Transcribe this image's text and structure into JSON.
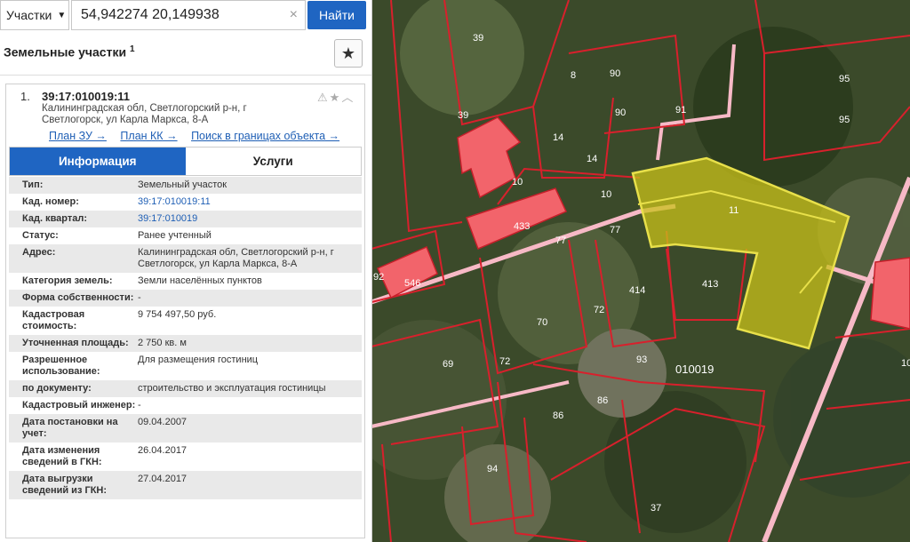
{
  "search": {
    "layer_select": "Участки",
    "query": "54,942274 20,149938",
    "find_button": "Найти"
  },
  "section": {
    "title": "Земельные участки",
    "count": "1"
  },
  "result": {
    "index": "1.",
    "cad_number": "39:17:010019:11",
    "address": "Калининградская обл, Светлогорский р-н, г Светлогорск, ул Карла Маркса, 8-А",
    "links": [
      "План ЗУ →",
      "План КК →",
      "Поиск в границах объекта →"
    ],
    "tabs": [
      "Информация",
      "Услуги"
    ],
    "rows": [
      {
        "k": "Тип:",
        "v": "Земельный участок"
      },
      {
        "k": "Кад. номер:",
        "v": "39:17:010019:11"
      },
      {
        "k": "Кад. квартал:",
        "v": "39:17:010019"
      },
      {
        "k": "Статус:",
        "v": "Ранее учтенный"
      },
      {
        "k": "Адрес:",
        "v": "Калининградская обл, Светлогорский р-н, г Светлогорск, ул Карла Маркса, 8-А"
      },
      {
        "k": "Категория земель:",
        "v": "Земли населённых пунктов"
      },
      {
        "k": "Форма собственности:",
        "v": "-"
      },
      {
        "k": "Кадастровая стоимость:",
        "v": "9 754 497,50 руб."
      },
      {
        "k": "Уточненная площадь:",
        "v": "2 750 кв. м"
      },
      {
        "k": "Разрешенное использование:",
        "v": "Для размещения гостиниц"
      },
      {
        "k": "по документу:",
        "v": "строительство и эксплуатация гостиницы"
      },
      {
        "k": "Кадастровый инженер:",
        "v": "-"
      },
      {
        "k": "Дата постановки на учет:",
        "v": "09.04.2007"
      },
      {
        "k": "Дата изменения сведений в ГКН:",
        "v": "26.04.2017"
      },
      {
        "k": "Дата выгрузки сведений из ГКН:",
        "v": "27.04.2017"
      }
    ]
  },
  "map": {
    "labels": [
      "39",
      "39",
      "90",
      "90",
      "8",
      "91",
      "95",
      "95",
      "14",
      "14",
      "10",
      "10",
      "11",
      "433",
      "77",
      "77",
      "92",
      "546",
      "414",
      "413",
      "70",
      "72",
      "69",
      "72",
      "93",
      "010019",
      "86",
      "86",
      "94",
      "37",
      "10"
    ],
    "colors": {
      "parcel_line": "#d8202c",
      "selected_fill": "#c9c21a",
      "building": "#f2646b"
    }
  }
}
